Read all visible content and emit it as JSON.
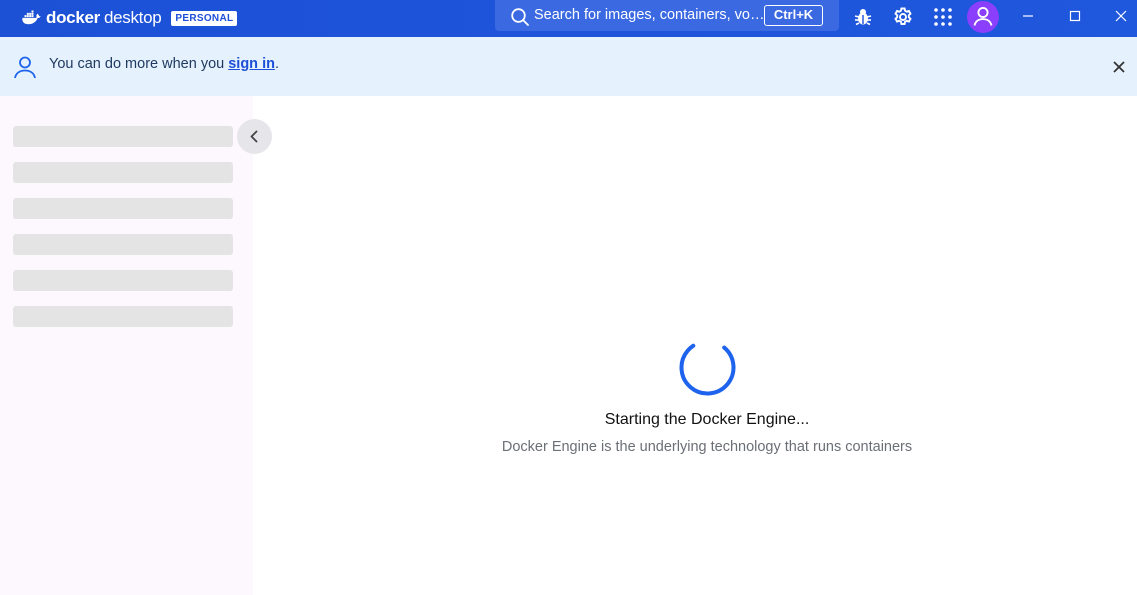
{
  "titlebar": {
    "brand_docker": "docker",
    "brand_desktop": "desktop",
    "plan_badge": "PERSONAL",
    "search_placeholder": "Search for images, containers, vo…",
    "search_shortcut": "Ctrl+K",
    "icons": [
      "whale-logo-icon",
      "search-icon",
      "bug-icon",
      "gear-icon",
      "apps-grid-icon",
      "user-icon",
      "minimize-icon",
      "maximize-icon",
      "close-icon"
    ],
    "colors": {
      "background": "#1d4fd8",
      "avatar": "#8a3ffc"
    }
  },
  "banner": {
    "text_before": "You can do more when you ",
    "link": "sign in",
    "text_after": ".",
    "background": "#e5f2fd"
  },
  "sidebar": {
    "skeleton_items": 6,
    "collapse_icon": "chevron-left-icon"
  },
  "main": {
    "status_title": "Starting the Docker Engine...",
    "status_subtitle": "Docker Engine is the underlying technology that runs containers",
    "spinner_color": "#1d63ed"
  }
}
